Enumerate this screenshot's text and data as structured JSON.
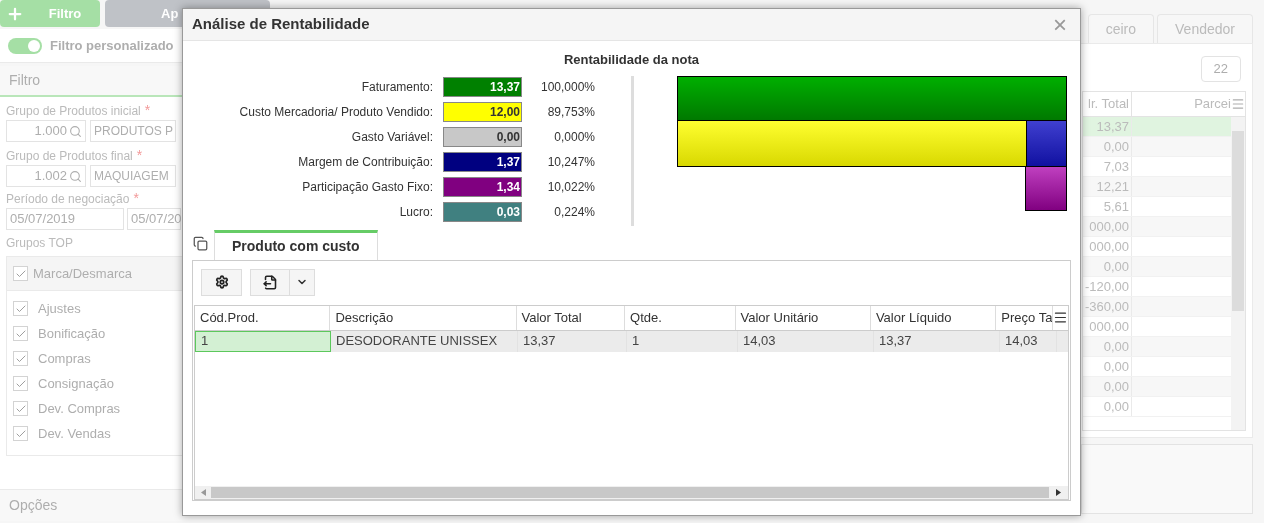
{
  "toolbar": {
    "buttons": [
      {
        "kind": "add",
        "label": "Filtro"
      },
      {
        "kind": "apply",
        "label": "Ap"
      }
    ]
  },
  "filter_toggle": {
    "label": "Filtro personalizado",
    "on": true
  },
  "filter_panel": {
    "title": "Filtro",
    "fields": [
      {
        "label": "Grupo de Produtos inicial",
        "required_mark": "*",
        "code": "1.000",
        "description": "PRODUTOS P"
      },
      {
        "label": "Grupo de Produtos final",
        "required_mark": "*",
        "code": "1.002",
        "description": "MAQUIAGEM"
      }
    ],
    "period": {
      "label": "Período de negociação",
      "required_mark": "*",
      "start": "05/07/2019",
      "end": "05/07/20"
    },
    "groups": {
      "label": "Grupos TOP",
      "toggle_all": {
        "label": "Marca/Desmarca",
        "checked": true
      },
      "items": [
        {
          "label": "Ajustes",
          "checked": true
        },
        {
          "label": "Bonificação",
          "checked": true
        },
        {
          "label": "Compras",
          "checked": true
        },
        {
          "label": "Consignação",
          "checked": true
        },
        {
          "label": "Dev. Compras",
          "checked": true
        },
        {
          "label": "Dev. Vendas",
          "checked": true
        }
      ]
    }
  },
  "options_panel": {
    "title": "Opções"
  },
  "background_tabs": [
    {
      "label": "ceiro",
      "selected": false
    },
    {
      "label": "Vendedor",
      "selected": false
    }
  ],
  "count_badge": "22",
  "background_table": {
    "columns": [
      "lr. Total",
      "Parcei"
    ],
    "rows": [
      {
        "total": "13,37",
        "selected": true
      },
      {
        "total": "0,00",
        "selected": false
      },
      {
        "total": "7,03",
        "selected": false
      },
      {
        "total": "12,21",
        "selected": false
      },
      {
        "total": "5,61",
        "selected": false
      },
      {
        "total": "000,00",
        "selected": false
      },
      {
        "total": "000,00",
        "selected": false
      },
      {
        "total": "0,00",
        "selected": false
      },
      {
        "total": "-120,00",
        "selected": false
      },
      {
        "total": "-360,00",
        "selected": false
      },
      {
        "total": "000,00",
        "selected": false
      },
      {
        "total": "0,00",
        "selected": false
      },
      {
        "total": "0,00",
        "selected": false
      },
      {
        "total": "0,00",
        "selected": false
      },
      {
        "total": "0,00",
        "selected": false
      }
    ]
  },
  "dialog": {
    "title": "Análise de Rentabilidade",
    "close": "×",
    "summary": {
      "title": "Rentabilidade da nota",
      "rows": [
        {
          "label": "Faturamento:",
          "value": "13,37",
          "percent": "100,000%",
          "color": "#008000"
        },
        {
          "label": "Custo Mercadoria/ Produto Vendido:",
          "value": "12,00",
          "percent": "89,753%",
          "color": "#ffff00"
        },
        {
          "label": "Gasto Variável:",
          "value": "0,00",
          "percent": "0,000%",
          "color": "#c8c8c8"
        },
        {
          "label": "Margem de Contribuição:",
          "value": "1,37",
          "percent": "10,247%",
          "color": "#000080"
        },
        {
          "label": "Participação Gasto Fixo:",
          "value": "1,34",
          "percent": "10,022%",
          "color": "#800080"
        },
        {
          "label": "Lucro:",
          "value": "0,03",
          "percent": "0,224%",
          "color": "#408080"
        }
      ]
    },
    "tabs": [
      {
        "label": "Produto com custo",
        "selected": true
      }
    ],
    "grid": {
      "columns": [
        "Cód.Prod.",
        "Descrição",
        "Valor Total",
        "Qtde.",
        "Valor Unitário",
        "Valor Líquido",
        "Preço Ta"
      ],
      "rows": [
        {
          "cells": [
            "1",
            "DESODORANTE UNISSEX",
            "13,37",
            "1",
            "14,03",
            "13,37",
            "14,03"
          ],
          "selected": true
        }
      ]
    }
  }
}
